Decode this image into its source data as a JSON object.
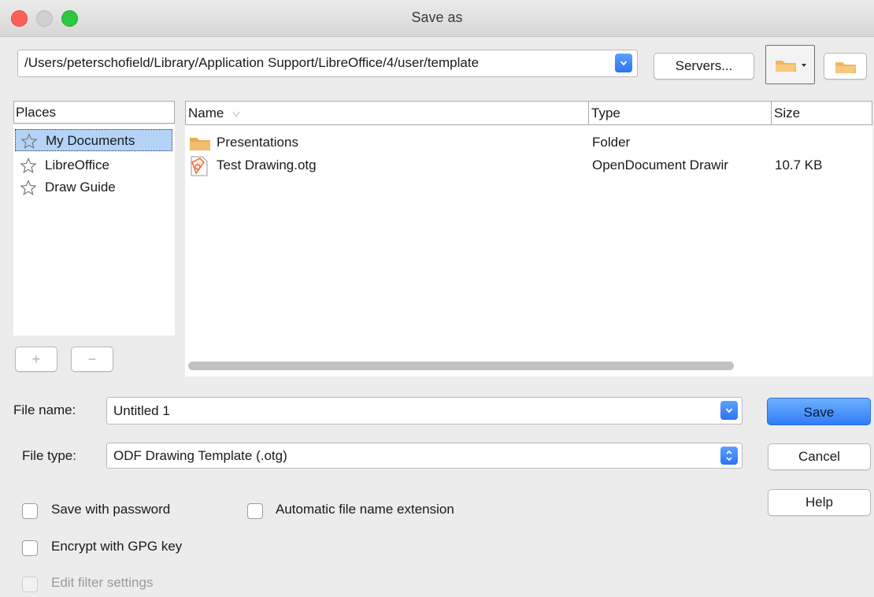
{
  "window": {
    "title": "Save as"
  },
  "toolbar": {
    "path": "/Users/peterschofield/Library/Application Support/LibreOffice/4/user/template",
    "servers_label": "Servers..."
  },
  "places": {
    "header": "Places",
    "items": [
      {
        "label": "My Documents"
      },
      {
        "label": "LibreOffice"
      },
      {
        "label": "Draw Guide"
      }
    ],
    "add_label": "+",
    "remove_label": "−"
  },
  "files": {
    "columns": {
      "name": "Name",
      "type": "Type",
      "size": "Size"
    },
    "rows": [
      {
        "name": "Presentations",
        "type": "Folder",
        "size": ""
      },
      {
        "name": "Test Drawing.otg",
        "type": "OpenDocument Drawir",
        "size": "10.7 KB"
      }
    ]
  },
  "form": {
    "file_name_label": "File name:",
    "file_name_value": "Untitled 1",
    "file_type_label": "File type:",
    "file_type_value": "ODF Drawing Template (.otg)"
  },
  "buttons": {
    "save": "Save",
    "cancel": "Cancel",
    "help": "Help"
  },
  "options": {
    "save_with_password": "Save with password",
    "auto_extension": "Automatic file name extension",
    "encrypt_gpg": "Encrypt with GPG key",
    "edit_filter": "Edit filter settings"
  },
  "colors": {
    "accent": "#2f7cf6",
    "selection": "#b4d3f7",
    "folder": "#f0b860"
  }
}
